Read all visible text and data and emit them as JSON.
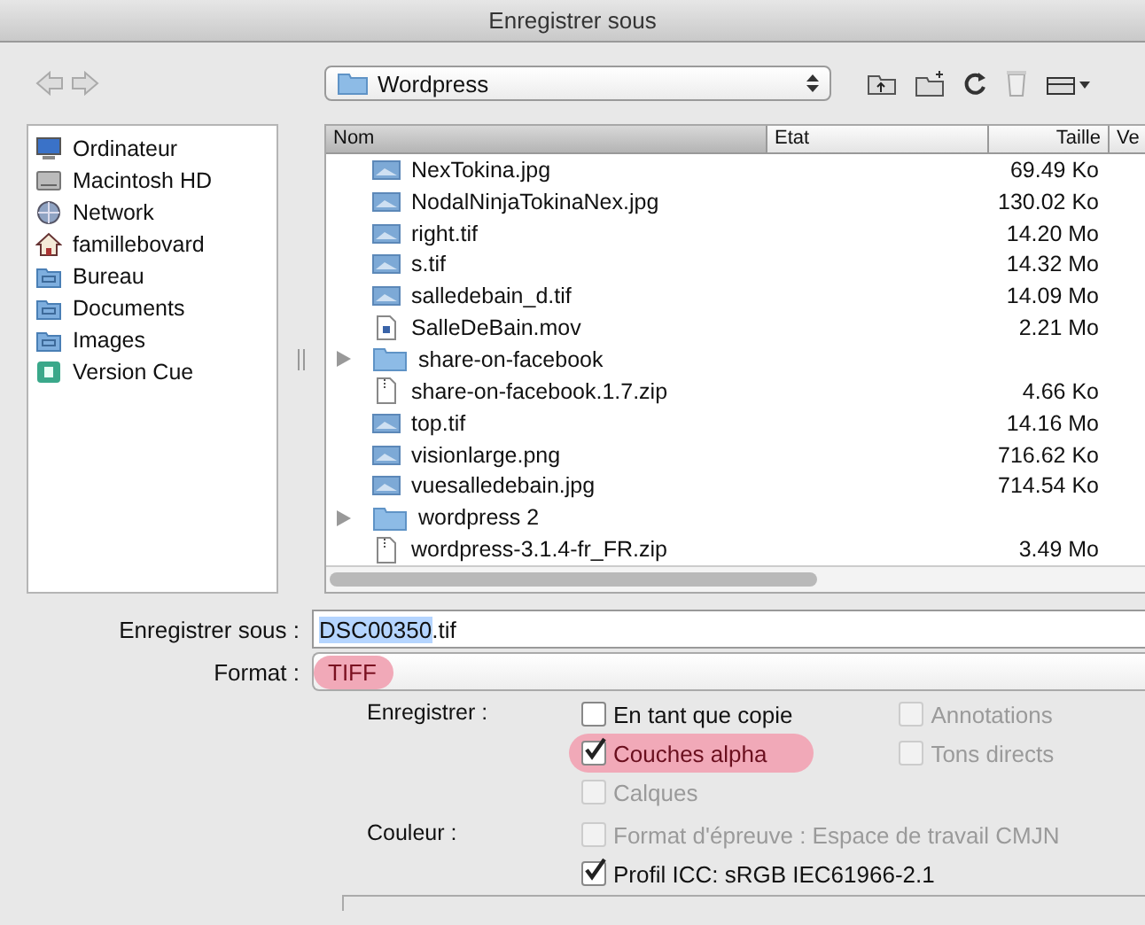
{
  "window": {
    "title": "Enregistrer sous"
  },
  "toolbar": {
    "location": "Wordpress"
  },
  "sidebar": {
    "items": [
      {
        "label": "Ordinateur",
        "kind": "computer"
      },
      {
        "label": "Macintosh HD",
        "kind": "drive"
      },
      {
        "label": "Network",
        "kind": "network"
      },
      {
        "label": "famillebovard",
        "kind": "home"
      },
      {
        "label": "Bureau",
        "kind": "folder"
      },
      {
        "label": "Documents",
        "kind": "folder"
      },
      {
        "label": "Images",
        "kind": "folder"
      },
      {
        "label": "Version Cue",
        "kind": "app"
      }
    ]
  },
  "table": {
    "columns": [
      {
        "label": "Nom",
        "selected": true
      },
      {
        "label": "Etat",
        "selected": false
      },
      {
        "label": "Taille",
        "selected": false
      },
      {
        "label": "Ve",
        "selected": false
      }
    ],
    "rows": [
      {
        "name": "NexTokina.jpg",
        "kind": "image",
        "size": "69.49 Ko"
      },
      {
        "name": "NodalNinjaTokinaNex.jpg",
        "kind": "image",
        "size": "130.02 Ko"
      },
      {
        "name": "right.tif",
        "kind": "image",
        "size": "14.20 Mo"
      },
      {
        "name": "s.tif",
        "kind": "image",
        "size": "14.32 Mo"
      },
      {
        "name": "salledebain_d.tif",
        "kind": "image",
        "size": "14.09 Mo"
      },
      {
        "name": "SalleDeBain.mov",
        "kind": "movie",
        "size": "2.21 Mo"
      },
      {
        "name": "share-on-facebook",
        "kind": "folder",
        "expanded": false
      },
      {
        "name": "share-on-facebook.1.7.zip",
        "kind": "zip",
        "size": "4.66 Ko"
      },
      {
        "name": "top.tif",
        "kind": "image",
        "size": "14.16 Mo"
      },
      {
        "name": "visionlarge.png",
        "kind": "image",
        "size": "716.62 Ko"
      },
      {
        "name": "vuesalledebain.jpg",
        "kind": "image",
        "size": "714.54 Ko"
      },
      {
        "name": "wordpress 2",
        "kind": "folder",
        "expanded": false
      },
      {
        "name": "wordpress-3.1.4-fr_FR.zip",
        "kind": "zip",
        "size": "3.49 Mo"
      }
    ]
  },
  "save_as": {
    "label": "Enregistrer sous :",
    "value_selected": "DSC00350",
    "value_rest": ".tif"
  },
  "format": {
    "label": "Format :",
    "value": "TIFF",
    "highlighted": true
  },
  "options": [
    {
      "label": "Enregistrer :",
      "columns": [
        [
          {
            "label": "En tant que copie",
            "checked": false,
            "disabled": false,
            "highlighted": false
          },
          {
            "label": "Couches alpha",
            "checked": true,
            "disabled": false,
            "highlighted": true
          },
          {
            "label": "Calques",
            "checked": false,
            "disabled": true,
            "highlighted": false
          }
        ],
        [
          {
            "label": "Annotations",
            "checked": false,
            "disabled": true,
            "highlighted": false
          },
          {
            "label": "Tons directs",
            "checked": false,
            "disabled": true,
            "highlighted": false
          }
        ]
      ]
    },
    {
      "label": "Couleur :",
      "columns": [
        [
          {
            "label": "Format d'épreuve : Espace de travail CMJN",
            "checked": false,
            "disabled": true,
            "highlighted": false
          },
          {
            "label": "Profil ICC:  sRGB IEC61966-2.1",
            "checked": true,
            "disabled": false,
            "highlighted": false
          }
        ]
      ]
    }
  ]
}
